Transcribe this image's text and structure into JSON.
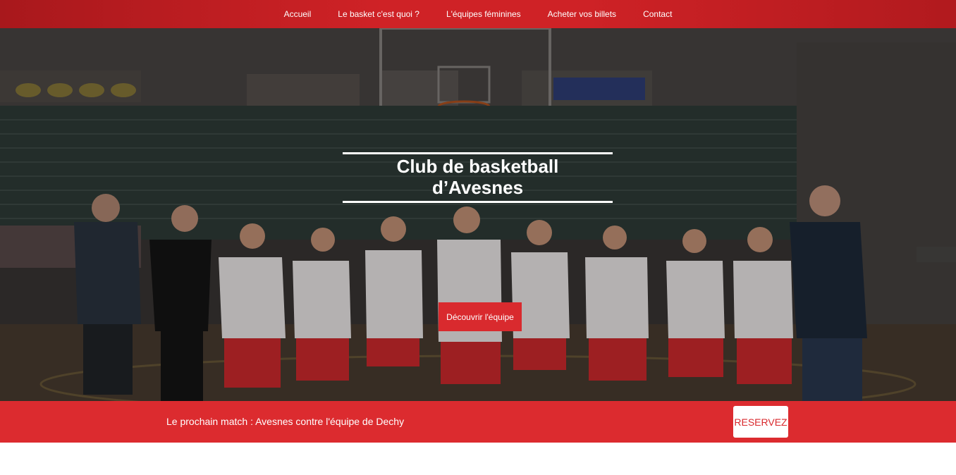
{
  "nav": {
    "items": [
      {
        "label": "Accueil"
      },
      {
        "label": "Le basket c'est quoi ?"
      },
      {
        "label": "L'équipes féminines"
      },
      {
        "label": "Acheter vos billets"
      },
      {
        "label": "Contact"
      }
    ]
  },
  "hero": {
    "title_line1": "Club de basketball",
    "title_line2": "d’Avesnes",
    "cta_label": "Découvrir l'équipe"
  },
  "banner": {
    "text": "Le prochain match : Avesnes contre l'équipe de Dechy",
    "button_label": "RESERVEZ"
  },
  "colors": {
    "brand_red": "#dc2b2f",
    "nav_red": "#c41e22",
    "white": "#ffffff"
  }
}
